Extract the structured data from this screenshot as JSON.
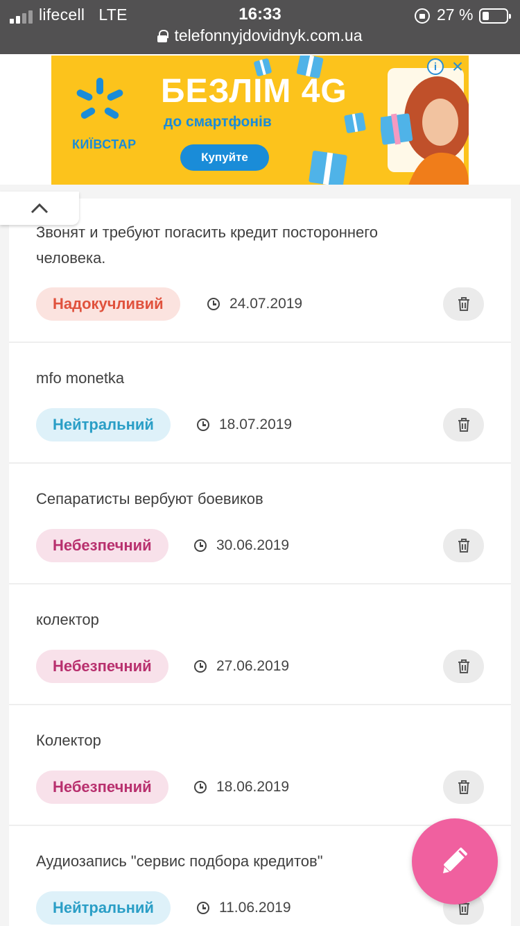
{
  "status_bar": {
    "carrier": "lifecell",
    "network": "LTE",
    "time": "16:33",
    "battery_percent": "27 %",
    "url": "telefonnyjdovidnyk.com.ua"
  },
  "ad": {
    "brand": "КИЇВСТАР",
    "title": "БЕЗЛІМ 4G",
    "subtitle": "до смартфонів",
    "cta": "Купуйте",
    "info_icon": "info-icon",
    "close_icon": "close-icon"
  },
  "comments": [
    {
      "text": "Звонят и требуют погасить кредит постороннего человека.",
      "rating": "Надокучливий",
      "rating_type": "annoying",
      "date": "24.07.2019"
    },
    {
      "text": "mfo monetka",
      "rating": "Нейтральний",
      "rating_type": "neutral",
      "date": "18.07.2019"
    },
    {
      "text": "Сепаратисты вербуют боевиков",
      "rating": "Небезпечний",
      "rating_type": "danger",
      "date": "30.06.2019"
    },
    {
      "text": "колектор",
      "rating": "Небезпечний",
      "rating_type": "danger",
      "date": "27.06.2019"
    },
    {
      "text": "Колектор",
      "rating": "Небезпечний",
      "rating_type": "danger",
      "date": "18.06.2019"
    },
    {
      "text": "Аудиозапись \"сервис подбора кредитов\"",
      "rating": "Нейтральний",
      "rating_type": "neutral",
      "date": "11.06.2019"
    }
  ],
  "colors": {
    "status_bar_bg": "#525152",
    "ad_bg": "#fcc31c",
    "fab_bg": "#f0609f",
    "annoying": "#e0523d",
    "neutral": "#2a9ec6",
    "danger": "#b8306e"
  }
}
